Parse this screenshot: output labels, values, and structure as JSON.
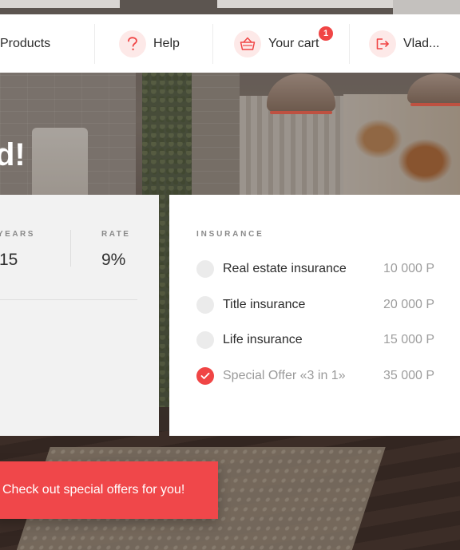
{
  "nav": {
    "products_label": "Products",
    "help_label": "Help",
    "cart_label": "Your cart",
    "cart_count": "1",
    "user_label": "Vlad...",
    "icons": {
      "help": "question-icon",
      "cart": "basket-icon",
      "user": "logout-icon"
    },
    "accent": "#f04545"
  },
  "hero": {
    "headline_fragment": "d!"
  },
  "stats": {
    "years_label": "YEARS",
    "years_value": "15",
    "rate_label": "RATE",
    "rate_value": "9%"
  },
  "insurance": {
    "title": "INSURANCE",
    "items": [
      {
        "name": "Real estate insurance",
        "price": "10 000 P",
        "checked": false
      },
      {
        "name": "Title insurance",
        "price": "20 000 P",
        "checked": false
      },
      {
        "name": "Life insurance",
        "price": "15 000 P",
        "checked": false
      },
      {
        "name": "Special Offer «3 in 1»",
        "price": "35 000 P",
        "checked": true
      }
    ]
  },
  "cta": {
    "label": "Check out special offers for you!"
  }
}
